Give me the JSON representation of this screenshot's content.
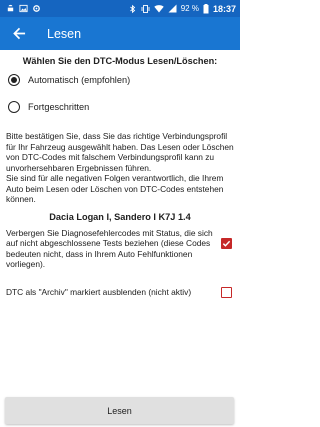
{
  "status_bar": {
    "battery": "92 %",
    "time": "18:37"
  },
  "app_bar": {
    "title": "Lesen"
  },
  "dtc_mode": {
    "heading": "Wählen Sie den DTC-Modus Lesen/Löschen:",
    "options": [
      {
        "label": "Automatisch (empfohlen)",
        "selected": true
      },
      {
        "label": "Fortgeschritten",
        "selected": false
      }
    ]
  },
  "info_text": "Bitte bestätigen Sie, dass Sie das richtige Verbindungsprofil für Ihr Fahrzeug ausgewählt haben. Das Lesen oder Löschen von DTC-Codes mit falschem Verbindungsprofil kann zu unvorhersehbaren Ergebnissen führen.\nSie sind für alle negativen Folgen verantwortlich, die Ihrem Auto beim Lesen oder Löschen von DTC-Codes entstehen können.",
  "vehicle": "Dacia Logan I, Sandero I K7J 1.4",
  "options": {
    "hide_pending": {
      "label": "Verbergen Sie Diagnosefehlercodes mit Status, die sich auf nicht abgeschlossene Tests beziehen (diese Codes bedeuten nicht, dass in Ihrem Auto Fehlfunktionen vorliegen).",
      "checked": true
    },
    "hide_archive": {
      "label": "DTC als \"Archiv\" markiert ausblenden (nicht aktiv)",
      "checked": false
    }
  },
  "read_button": "Lesen",
  "colors": {
    "status_bar": "#1565c0",
    "app_bar": "#1976d2",
    "checkbox": "#c62828"
  }
}
